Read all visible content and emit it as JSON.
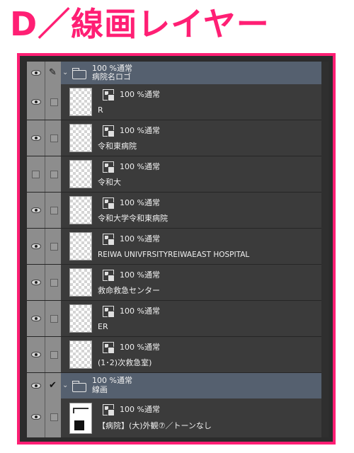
{
  "heading": "D／線画レイヤー",
  "colors": {
    "accent": "#ff1f74",
    "folder_row": "#55606f",
    "layer_row": "#3b3b3b"
  },
  "folders": [
    {
      "opacity_mode": "100 %通常",
      "name": "病院名ロゴ",
      "eye": "eye-icon",
      "lock": "pen-icon",
      "expanded": true
    },
    {
      "opacity_mode": "100 %通常",
      "name": "線画",
      "eye": "eye-icon",
      "lock": "check-icon",
      "expanded": true
    }
  ],
  "layers": [
    {
      "opacity_mode": "100 %通常",
      "name": "R",
      "visible": true
    },
    {
      "opacity_mode": "100 %通常",
      "name": "令和東病院",
      "visible": true
    },
    {
      "opacity_mode": "100 %通常",
      "name": "令和大",
      "visible": false
    },
    {
      "opacity_mode": "100 %通常",
      "name": "令和大学令和東病院",
      "visible": true
    },
    {
      "opacity_mode": "100 %通常",
      "name": "REIWA UNIVFRSITYREIWAEAST HOSPITAL",
      "visible": true
    },
    {
      "opacity_mode": "100 %通常",
      "name": "救命救急センター",
      "visible": true
    },
    {
      "opacity_mode": "100 %通常",
      "name": "ER",
      "visible": true
    },
    {
      "opacity_mode": "100 %通常",
      "name": "(1･2)次救急室)",
      "visible": true
    },
    {
      "opacity_mode": "100 %通常",
      "name": "【病院】(大)外観⑦／トーンなし",
      "visible": true
    }
  ]
}
